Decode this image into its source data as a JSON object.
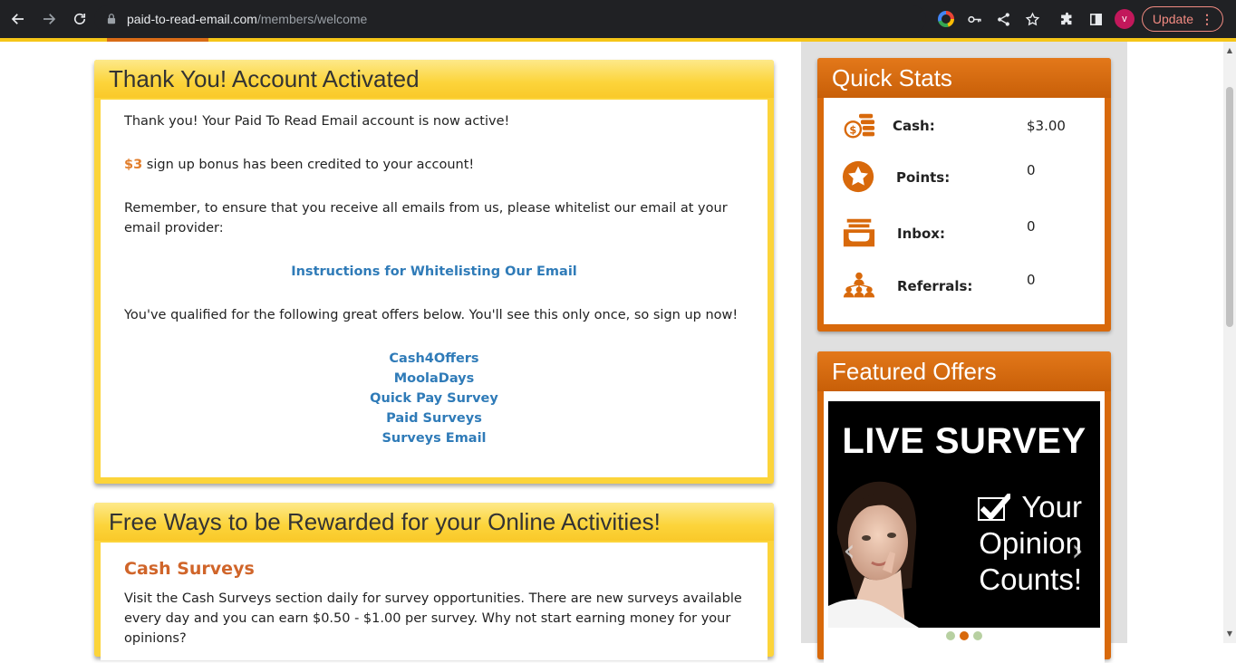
{
  "browser": {
    "url_host": "paid-to-read-email.com",
    "url_path": "/members/welcome",
    "update_label": "Update",
    "avatar_letter": "v"
  },
  "welcome_panel": {
    "title": "Thank You! Account Activated",
    "line1": "Thank you! Your Paid To Read Email account is now active!",
    "bonus_amount": "$3",
    "bonus_text": " sign up bonus has been credited to your account!",
    "whitelist_text": "Remember, to ensure that you receive all emails from us, please whitelist our email at your email provider:",
    "whitelist_link": "Instructions for Whitelisting Our Email",
    "offers_intro": "You've qualified for the following great offers below. You'll see this only once, so sign up now!",
    "offers": [
      "Cash4Offers",
      "MoolaDays",
      "Quick Pay Survey",
      "Paid Surveys",
      "Surveys Email"
    ]
  },
  "rewards_panel": {
    "title": "Free Ways to be Rewarded for your Online Activities!",
    "section_title": "Cash Surveys",
    "section_text": "Visit the Cash Surveys section daily for survey opportunities. There are new surveys available every day and you can earn $0.50 - $1.00 per survey. Why not start earning money for your opinions?"
  },
  "quick_stats": {
    "title": "Quick Stats",
    "stats": [
      {
        "label": "Cash:",
        "value": "$3.00",
        "icon": "coins-icon"
      },
      {
        "label": "Points:",
        "value": "0",
        "icon": "star-icon"
      },
      {
        "label": "Inbox:",
        "value": "0",
        "icon": "inbox-icon"
      },
      {
        "label": "Referrals:",
        "value": "0",
        "icon": "referrals-icon"
      }
    ]
  },
  "featured_offers": {
    "title": "Featured Offers",
    "banner_title": "LIVE SURVEY",
    "banner_line1": "Your",
    "banner_line2": "Opinion",
    "banner_line3": "Counts!"
  },
  "colors": {
    "accent_yellow": "#fcd43a",
    "accent_orange": "#d8690b",
    "link_blue": "#2f7bb8"
  }
}
